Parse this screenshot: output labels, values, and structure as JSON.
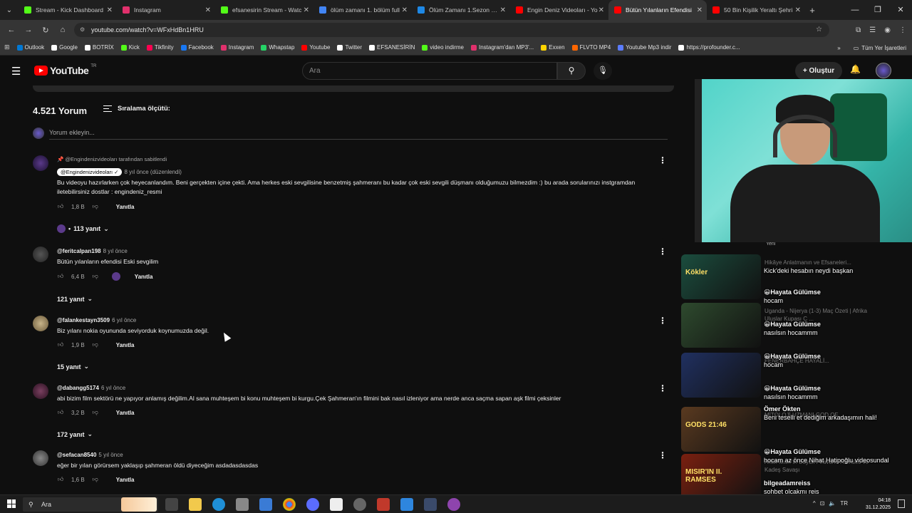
{
  "browser": {
    "tabs": [
      {
        "title": "Stream - Kick Dashboard",
        "color": "#53fc18"
      },
      {
        "title": "Instagram",
        "color": "#e1306c"
      },
      {
        "title": "efsanesirin Stream - Watc",
        "color": "#53fc18"
      },
      {
        "title": "ölüm zamanı 1. bölüm full",
        "color": "#4285f4"
      },
      {
        "title": "Ölüm Zamanı 1.Sezon 1.B",
        "color": "#1e88e5"
      },
      {
        "title": "Engin Deniz Videoları - Yo",
        "color": "#ff0000"
      },
      {
        "title": "Bütün Yılanların Efendisi",
        "color": "#ff0000"
      },
      {
        "title": "50 Bin Kişilik Yeraltı Şehri",
        "color": "#ff0000"
      }
    ],
    "url": "youtube.com/watch?v=WFxHdBn1HRU",
    "bookmarks": [
      {
        "label": "Outlook",
        "color": "#0078d4"
      },
      {
        "label": "Google",
        "color": "#ffffff"
      },
      {
        "label": "BOTRİX",
        "color": "#ffffff"
      },
      {
        "label": "Kick",
        "color": "#53fc18"
      },
      {
        "label": "Tikfinity",
        "color": "#ff0050"
      },
      {
        "label": "Facebook",
        "color": "#1877f2"
      },
      {
        "label": "Instagram",
        "color": "#e1306c"
      },
      {
        "label": "Whapstap",
        "color": "#25d366"
      },
      {
        "label": "Youtube",
        "color": "#ff0000"
      },
      {
        "label": "Twitter",
        "color": "#ffffff"
      },
      {
        "label": "EFSANESİRİN",
        "color": "#ffffff"
      },
      {
        "label": "video indirme",
        "color": "#53fc18"
      },
      {
        "label": "Instagram'dan MP3'...",
        "color": "#e1306c"
      },
      {
        "label": "Exxen",
        "color": "#ffd400"
      },
      {
        "label": "FLVTO MP4",
        "color": "#ff6600"
      },
      {
        "label": "Youtube Mp3 indir",
        "color": "#5b7cff"
      },
      {
        "label": "https://profounder.c...",
        "color": "#ffffff"
      }
    ],
    "bookmarks_more": "»",
    "all_bookmarks": "Tüm Yer İşaretleri"
  },
  "youtube": {
    "logo_text": "YouTube",
    "logo_region": "TR",
    "search_placeholder": "Ara",
    "create_label": "Oluştur"
  },
  "comments": {
    "count_label": "4.521 Yorum",
    "sort_label": "Sıralama ölçütü:",
    "add_placeholder": "Yorum ekleyin...",
    "pinned_label": "@Engindenizvideoları tarafından sabitlendi",
    "items": [
      {
        "author": "@Engindenizvideoları",
        "ago": "8 yıl önce (düzenlendi)",
        "text": "Bu videoyu hazırlarken çok heyecanlandım. Beni gerçekten içine çekti. Ama herkes eski sevgilisine benzetmiş şahmeranı bu kadar çok eski sevgili düşmanı olduğumuzu bilmezdim :) bu arada sorularınızı instgramdan iletebilirsiniz dostlar : engindeniz_resmi",
        "likes": "1,8 B",
        "reply_label": "Yanıtla",
        "replies": "113 yanıt"
      },
      {
        "author": "@feritcalpan198",
        "ago": "8 yıl önce",
        "text": "Bütün yılanların efendisi Eski sevgilim",
        "likes": "6,4 B",
        "reply_label": "Yanıtla",
        "replies": "121 yanıt"
      },
      {
        "author": "@falankestayn3509",
        "ago": "6 yıl önce",
        "text": "Biz yılanı nokia oyununda seviyorduk koynumuzda değil.",
        "likes": "1,9 B",
        "reply_label": "Yanıtla",
        "replies": "15 yanıt"
      },
      {
        "author": "@dabangg5174",
        "ago": "6 yıl önce",
        "text": "abi bizim film sektörü ne yapıyor anlamış değilim.Al sana muhteşem bi konu muhteşem bi kurgu.Çek Şahmeran'ın filmini bak nasıl izleniyor ama nerde anca saçma sapan aşk filmi çeksinler",
        "likes": "3,2 B",
        "reply_label": "Yanıtla",
        "replies": "172 yanıt"
      },
      {
        "author": "@sefacan8540",
        "ago": "5 yıl önce",
        "text": "eğer bir yılan görürsem yaklaşıp şahmeran öldü diyeceğim asdadasdasdas",
        "likes": "1,6 B",
        "reply_label": "Yanıtla",
        "replies": ""
      }
    ]
  },
  "sidebar": {
    "new_badge": "Yeni",
    "videos": [
      {
        "title": "Hikâye Anlatmanın ve Efsaneleri...",
        "thumb_text": "Kökler",
        "color": "#1b4d3e"
      },
      {
        "title": "Uganda - Nijerya (1-3) Maç Özeti | Afrika Uluslar Kupası C ...",
        "thumb_text": "",
        "color": "#2e4a2e"
      },
      {
        "title": "FENERBAHÇE HAYALİ...",
        "thumb_text": "",
        "color": "#203060"
      },
      {
        "title": "MİTOLOJİ UZMANI GOD OF...",
        "thumb_text": "GODS 21:46",
        "color": "#5a3a20"
      },
      {
        "title": "Antik Mısır'ın Büyük Firavunu Ramses ve Kadeş Savaşı",
        "thumb_text": "MISIR'IN II. RAMSES",
        "color": "#7a2010"
      }
    ]
  },
  "chat": [
    {
      "user": "",
      "text": "Kick'deki hesabın neydi başkan"
    },
    {
      "user": "😀Hayata Gülümse",
      "text": "hocam"
    },
    {
      "user": "😀Hayata Gülümse",
      "text": "nasılsın hocammm"
    },
    {
      "user": "😀Hayata Gülümse",
      "text": "hocam"
    },
    {
      "user": "😀Hayata Gülümse",
      "text": "nasılsın hocammm"
    },
    {
      "user": "Ömer Ökten",
      "text": "Beni teselli et dediğim arkadaşımın hali!"
    },
    {
      "user": "😀Hayata Gülümse",
      "text": "hocam az önce Nihat Hatipoğlu videosundal"
    },
    {
      "user": "bilgeadamreiss",
      "text": "sohbet olcakmı reis"
    }
  ],
  "taskbar": {
    "search_placeholder": "Ara",
    "time": "04:18",
    "date": "31.12.2025"
  }
}
